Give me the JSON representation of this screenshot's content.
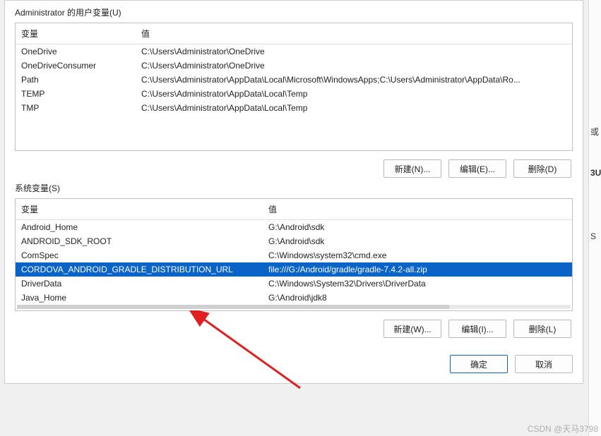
{
  "watermark": "CSDN @天马3798",
  "user_group": {
    "label": "Administrator 的用户变量(U)",
    "col_variable": "变量",
    "col_value": "值",
    "rows": [
      {
        "name": "OneDrive",
        "value": "C:\\Users\\Administrator\\OneDrive"
      },
      {
        "name": "OneDriveConsumer",
        "value": "C:\\Users\\Administrator\\OneDrive"
      },
      {
        "name": "Path",
        "value": "C:\\Users\\Administrator\\AppData\\Local\\Microsoft\\WindowsApps;C:\\Users\\Administrator\\AppData\\Ro..."
      },
      {
        "name": "TEMP",
        "value": "C:\\Users\\Administrator\\AppData\\Local\\Temp"
      },
      {
        "name": "TMP",
        "value": "C:\\Users\\Administrator\\AppData\\Local\\Temp"
      }
    ],
    "btn_new": "新建(N)...",
    "btn_edit": "编辑(E)...",
    "btn_del": "删除(D)"
  },
  "sys_group": {
    "label": "系统变量(S)",
    "col_variable": "变量",
    "col_value": "值",
    "rows": [
      {
        "name": "Android_Home",
        "value": "G:\\Android\\sdk"
      },
      {
        "name": "ANDROID_SDK_ROOT",
        "value": "G:\\Android\\sdk"
      },
      {
        "name": "ComSpec",
        "value": "C:\\Windows\\system32\\cmd.exe"
      },
      {
        "name": "CORDOVA_ANDROID_GRADLE_DISTRIBUTION_URL",
        "value": "file:///G:/Android/gradle/gradle-7.4.2-all.zip"
      },
      {
        "name": "DriverData",
        "value": "C:\\Windows\\System32\\Drivers\\DriverData"
      },
      {
        "name": "Java_Home",
        "value": "G:\\Android\\jdk8"
      }
    ],
    "selected_index": 3,
    "btn_new": "新建(W)...",
    "btn_edit": "编辑(I)...",
    "btn_del": "删除(L)"
  },
  "footer": {
    "ok": "确定",
    "cancel": "取消"
  }
}
